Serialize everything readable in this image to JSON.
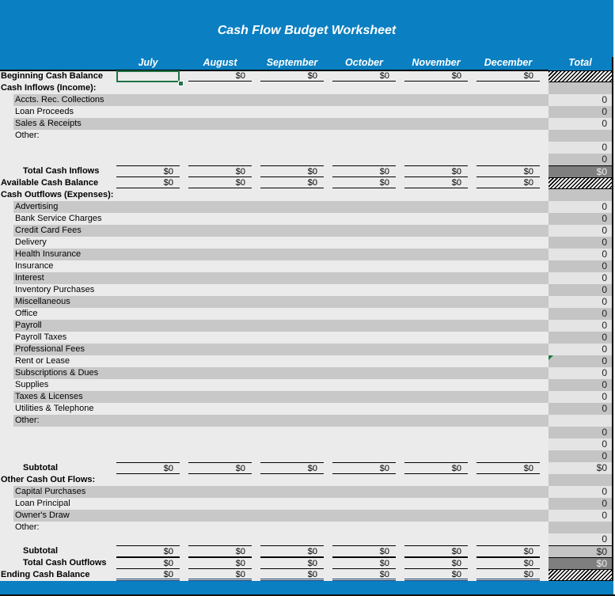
{
  "title": "Cash Flow Budget Worksheet",
  "columns": [
    "July",
    "August",
    "September",
    "October",
    "November",
    "December",
    "Total"
  ],
  "rows": [
    {
      "label": "Beginning Cash Balance",
      "type": "balance",
      "values": [
        "",
        "$0",
        "$0",
        "$0",
        "$0",
        "$0"
      ],
      "total": "",
      "total_style": "hatch"
    },
    {
      "label": "Cash Inflows (Income):",
      "type": "section",
      "values": [],
      "total": "",
      "total_style": "td"
    },
    {
      "label": "Accts. Rec. Collections",
      "type": "item",
      "band": true,
      "values": [],
      "total": "0",
      "total_style": "tl"
    },
    {
      "label": "Loan Proceeds",
      "type": "item",
      "band": false,
      "values": [],
      "total": "0",
      "total_style": "td"
    },
    {
      "label": "Sales & Receipts",
      "type": "item",
      "band": true,
      "values": [],
      "total": "0",
      "total_style": "tl"
    },
    {
      "label": "Other:",
      "type": "item",
      "band": false,
      "values": [],
      "total": "",
      "total_style": "td"
    },
    {
      "label": "",
      "type": "blank",
      "values": [],
      "total": "0",
      "total_style": "tl"
    },
    {
      "label": "",
      "type": "blank",
      "values": [],
      "total": "0",
      "total_style": "td"
    },
    {
      "label": "Total Cash Inflows",
      "type": "subtotal",
      "values": [
        "$0",
        "$0",
        "$0",
        "$0",
        "$0",
        "$0"
      ],
      "total": "$0",
      "total_style": "tdark"
    },
    {
      "label": "Available Cash Balance",
      "type": "balance",
      "values": [
        "$0",
        "$0",
        "$0",
        "$0",
        "$0",
        "$0"
      ],
      "total": "",
      "total_style": "hatch"
    },
    {
      "label": "Cash Outflows (Expenses):",
      "type": "section",
      "values": [],
      "total": "",
      "total_style": "td"
    },
    {
      "label": "Advertising",
      "type": "item",
      "band": true,
      "values": [],
      "total": "0",
      "total_style": "tl"
    },
    {
      "label": "Bank Service Charges",
      "type": "item",
      "band": false,
      "values": [],
      "total": "0",
      "total_style": "td"
    },
    {
      "label": "Credit Card Fees",
      "type": "item",
      "band": true,
      "values": [],
      "total": "0",
      "total_style": "tl"
    },
    {
      "label": "Delivery",
      "type": "item",
      "band": false,
      "values": [],
      "total": "0",
      "total_style": "td"
    },
    {
      "label": "Health Insurance",
      "type": "item",
      "band": true,
      "values": [],
      "total": "0",
      "total_style": "tl"
    },
    {
      "label": "Insurance",
      "type": "item",
      "band": false,
      "values": [],
      "total": "0",
      "total_style": "td"
    },
    {
      "label": "Interest",
      "type": "item",
      "band": true,
      "values": [],
      "total": "0",
      "total_style": "tl"
    },
    {
      "label": "Inventory Purchases",
      "type": "item",
      "band": false,
      "values": [],
      "total": "0",
      "total_style": "td"
    },
    {
      "label": "Miscellaneous",
      "type": "item",
      "band": true,
      "values": [],
      "total": "0",
      "total_style": "tl"
    },
    {
      "label": "Office",
      "type": "item",
      "band": false,
      "values": [],
      "total": "0",
      "total_style": "td"
    },
    {
      "label": "Payroll",
      "type": "item",
      "band": true,
      "values": [],
      "total": "0",
      "total_style": "tl"
    },
    {
      "label": "Payroll Taxes",
      "type": "item",
      "band": false,
      "values": [],
      "total": "0",
      "total_style": "td"
    },
    {
      "label": "Professional Fees",
      "type": "item",
      "band": true,
      "values": [],
      "total": "0",
      "total_style": "tl"
    },
    {
      "label": "Rent or Lease",
      "type": "item",
      "band": false,
      "values": [],
      "total": "0",
      "total_style": "td"
    },
    {
      "label": "Subscriptions & Dues",
      "type": "item",
      "band": true,
      "values": [],
      "total": "0",
      "total_style": "tl"
    },
    {
      "label": "Supplies",
      "type": "item",
      "band": false,
      "values": [],
      "total": "0",
      "total_style": "td"
    },
    {
      "label": "Taxes & Licenses",
      "type": "item",
      "band": true,
      "values": [],
      "total": "0",
      "total_style": "tl"
    },
    {
      "label": "Utilities & Telephone",
      "type": "item",
      "band": false,
      "values": [],
      "total": "0",
      "total_style": "td"
    },
    {
      "label": "Other:",
      "type": "item",
      "band": true,
      "values": [],
      "total": "",
      "total_style": "tl"
    },
    {
      "label": "",
      "type": "blank",
      "values": [],
      "total": "0",
      "total_style": "td"
    },
    {
      "label": "",
      "type": "blank",
      "values": [],
      "total": "0",
      "total_style": "tl"
    },
    {
      "label": "",
      "type": "blank",
      "values": [],
      "total": "0",
      "total_style": "td"
    },
    {
      "label": "Subtotal",
      "type": "subtotal",
      "values": [
        "$0",
        "$0",
        "$0",
        "$0",
        "$0",
        "$0"
      ],
      "total": "$0",
      "total_style": "tl"
    },
    {
      "label": "Other Cash Out Flows:",
      "type": "section",
      "values": [],
      "total": "",
      "total_style": "td"
    },
    {
      "label": "Capital Purchases",
      "type": "item",
      "band": true,
      "values": [],
      "total": "0",
      "total_style": "tl"
    },
    {
      "label": "Loan Principal",
      "type": "item",
      "band": false,
      "values": [],
      "total": "0",
      "total_style": "td"
    },
    {
      "label": "Owner's Draw",
      "type": "item",
      "band": true,
      "values": [],
      "total": "0",
      "total_style": "tl"
    },
    {
      "label": "Other:",
      "type": "item",
      "band": false,
      "values": [],
      "total": "",
      "total_style": "td"
    },
    {
      "label": "",
      "type": "blank",
      "values": [],
      "total": "0",
      "total_style": "tl"
    },
    {
      "label": "Subtotal",
      "type": "subtotal",
      "values": [
        "$0",
        "$0",
        "$0",
        "$0",
        "$0",
        "$0"
      ],
      "total": "$0",
      "total_style": "tmid"
    },
    {
      "label": "Total Cash Outflows",
      "type": "subtotal",
      "values": [
        "$0",
        "$0",
        "$0",
        "$0",
        "$0",
        "$0"
      ],
      "total": "$0",
      "total_style": "tdark"
    },
    {
      "label": "Ending Cash Balance",
      "type": "ending",
      "values": [
        "$0",
        "$0",
        "$0",
        "$0",
        "$0",
        "$0"
      ],
      "total": "",
      "total_style": "hatch"
    }
  ],
  "selected_cell": "July / Beginning Cash Balance",
  "colors": {
    "header_blue": "#0a7fc2",
    "selection_green": "#217346"
  }
}
